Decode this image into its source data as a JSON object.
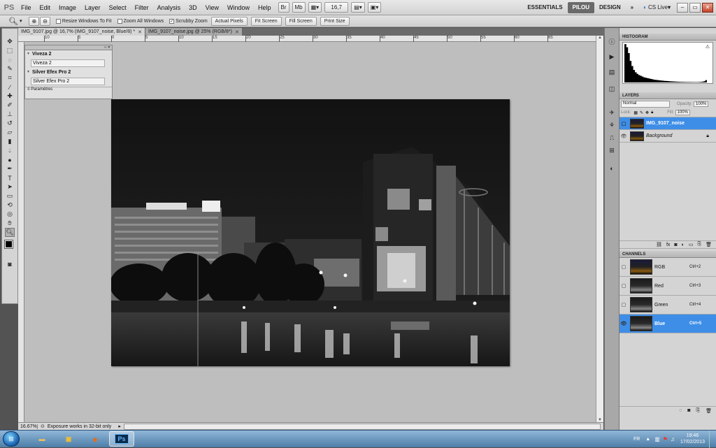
{
  "menubar": {
    "app_logo": "PS",
    "items": [
      "File",
      "Edit",
      "Image",
      "Layer",
      "Select",
      "Filter",
      "Analysis",
      "3D",
      "View",
      "Window",
      "Help"
    ],
    "br_label": "Br",
    "mb_label": "Mb",
    "zoom_value": "16,7",
    "workspaces": [
      "ESSENTIALS",
      "PILOU",
      "DESIGN"
    ],
    "active_workspace": "PILOU",
    "more": "»",
    "cs_live": "CS Live"
  },
  "options": {
    "resize_windows": "Resize Windows To Fit",
    "zoom_all": "Zoom All Windows",
    "scrubby_zoom": "Scrubby Zoom",
    "buttons": [
      "Actual Pixels",
      "Fit Screen",
      "Fill Screen",
      "Print Size"
    ]
  },
  "tabs": [
    {
      "label": "IMG_9107.jpg @ 16,7% (IMG_9107_noise, Blue/8) *",
      "active": true
    },
    {
      "label": "IMG_9107_noise.jpg @ 25% (RGB/8*)",
      "active": false
    }
  ],
  "ruler_ticks": [
    "10",
    "5",
    "0",
    "5",
    "10",
    "15",
    "20",
    "25",
    "30",
    "35",
    "40",
    "45",
    "50",
    "55",
    "60",
    "65"
  ],
  "plugin_panel": {
    "section1_title": "Viveza 2",
    "section1_field": "Viveza 2",
    "section2_title": "Silver Efex Pro 2",
    "section2_field": "Silver Efex Pro 2",
    "footer": "Paramètres"
  },
  "status": {
    "zoom": "16.67%",
    "message": "Exposure works in 32-bit only"
  },
  "histogram": {
    "title": "HISTOGRAM",
    "levels": [
      0.98,
      0.9,
      0.75,
      0.55,
      0.42,
      0.32,
      0.26,
      0.22,
      0.19,
      0.17,
      0.15,
      0.13,
      0.12,
      0.11,
      0.1,
      0.09,
      0.08,
      0.07,
      0.065,
      0.06,
      0.055,
      0.05,
      0.045,
      0.04,
      0.038,
      0.035,
      0.03,
      0.028,
      0.025,
      0.022,
      0.02,
      0.018,
      0.016,
      0.015,
      0.014,
      0.013,
      0.012,
      0.012,
      0.011,
      0.011,
      0.01,
      0.01,
      0.01,
      0.012,
      0.015,
      0.02,
      0.03,
      0.06
    ]
  },
  "layers": {
    "title": "LAYERS",
    "blend_mode": "Normal",
    "opacity_label": "Opacity:",
    "opacity_value": "100%",
    "lock_label": "Lock:",
    "fill_label": "Fill:",
    "fill_value": "100%",
    "items": [
      {
        "name": "IMG_9107_noise",
        "selected": true
      },
      {
        "name": "Background",
        "selected": false
      }
    ]
  },
  "channels": {
    "title": "CHANNELS",
    "items": [
      {
        "name": "RGB",
        "shortcut": "Ctrl+2",
        "selected": false
      },
      {
        "name": "Red",
        "shortcut": "Ctrl+3",
        "selected": false
      },
      {
        "name": "Green",
        "shortcut": "Ctrl+4",
        "selected": false
      },
      {
        "name": "Blue",
        "shortcut": "Ctrl+5",
        "selected": true
      }
    ]
  },
  "taskbar": {
    "language": "FR",
    "time": "19:46",
    "date": "17/02/2013",
    "ps_label": "Ps"
  },
  "colors": {
    "selection": "#3e8ee8",
    "canvas_bg": "#bebebe"
  }
}
